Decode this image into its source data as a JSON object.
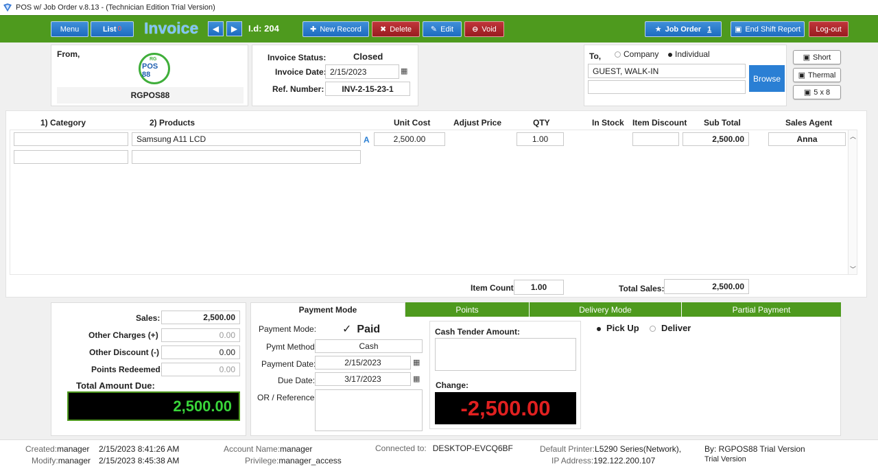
{
  "window": {
    "title": "POS w/ Job Order v.8.13 - (Technician Edition Trial Version)"
  },
  "toolbar": {
    "menu": "Menu",
    "list": "List",
    "list_badge": "0",
    "screen_label": "Invoice",
    "id_label": "I.d: 204",
    "new_record": "New Record",
    "delete": "Delete",
    "edit": "Edit",
    "void": "Void",
    "job_order": "Job Order",
    "job_order_count": "1",
    "end_shift": "End Shift Report",
    "logout": "Log-out"
  },
  "from": {
    "label": "From,",
    "company": "RGPOS88",
    "logo_top": "RG",
    "logo_main": "POS 88"
  },
  "invoice": {
    "status_label": "Invoice Status:",
    "status_value": "Closed",
    "date_label": "Invoice Date:",
    "date_value": "2/15/2023",
    "ref_label": "Ref. Number:",
    "ref_value": "INV-2-15-23-1"
  },
  "to": {
    "label": "To,",
    "company_option": "Company",
    "individual_option": "Individual",
    "customer": "GUEST, WALK-IN",
    "customer2": "",
    "browse": "Browse"
  },
  "print": {
    "short": "Short",
    "thermal": "Thermal",
    "five_by_eight": "5 x 8"
  },
  "grid": {
    "headers": {
      "category": "1) Category",
      "products": "2) Products",
      "unit_cost": "Unit Cost",
      "adjust_price": "Adjust Price",
      "qty": "QTY",
      "in_stock": "In Stock",
      "item_discount": "Item Discount",
      "sub_total": "Sub Total",
      "sales_agent": "Sales Agent"
    },
    "rows": [
      {
        "category": "",
        "product": "Samsung A11 LCD",
        "flag": "A",
        "unit_cost": "2,500.00",
        "qty": "1.00",
        "item_discount": "",
        "sub_total": "2,500.00",
        "agent": "Anna"
      }
    ],
    "item_count_label": "Item Count",
    "item_count": "1.00",
    "total_sales_label": "Total Sales:",
    "total_sales": "2,500.00"
  },
  "summary": {
    "sales_label": "Sales:",
    "sales": "2,500.00",
    "other_charges_label": "Other Charges (+) :",
    "other_charges": "0.00",
    "other_discount_label": "Other Discount (-) :",
    "other_discount": "0.00",
    "points_label": "Points Redeemed:",
    "points": "0.00",
    "total_label": "Total Amount Due:",
    "total": "2,500.00"
  },
  "tabs": [
    "Payment Mode",
    "Points",
    "Delivery Mode",
    "Partial Payment"
  ],
  "payment": {
    "mode_label": "Payment Mode:",
    "mode_value": "Paid",
    "check": "✓",
    "method_label": "Pymt Method:",
    "method_value": "Cash",
    "date_label": "Payment Date:",
    "date_value": "2/15/2023",
    "due_label": "Due Date:",
    "due_value": "3/17/2023",
    "or_label": "OR / Reference:",
    "cash_tender_label": "Cash Tender Amount:",
    "change_label": "Change:",
    "change_value": "-2,500.00"
  },
  "delivery": {
    "pickup": "Pick Up",
    "deliver": "Deliver"
  },
  "status": {
    "created_k": "Created:",
    "created_v": "manager",
    "created_t": "2/15/2023 8:41:26 AM",
    "modify_k": "Modify:",
    "modify_v": "manager",
    "modify_t": "2/15/2023 8:45:38 AM",
    "account_k": "Account Name:",
    "account_v": "manager",
    "privilege_k": "Privilege:",
    "privilege_v": "manager_access",
    "connected_k": "Connected to:",
    "connected_v": "DESKTOP-EVCQ6BF",
    "printer_k": "Default Printer:",
    "printer_v": "L5290 Series(Network),",
    "ip_k": "IP Address:",
    "ip_v": "192.122.200.107",
    "by": "By: RGPOS88 Trial Version",
    "trial": "Trial Version"
  },
  "colors": {
    "toolbar_green": "#4e9a1e",
    "button_blue": "#1e6cc0",
    "button_red": "#9a1c20",
    "total_green": "#39d53a",
    "change_red": "#e02020"
  }
}
